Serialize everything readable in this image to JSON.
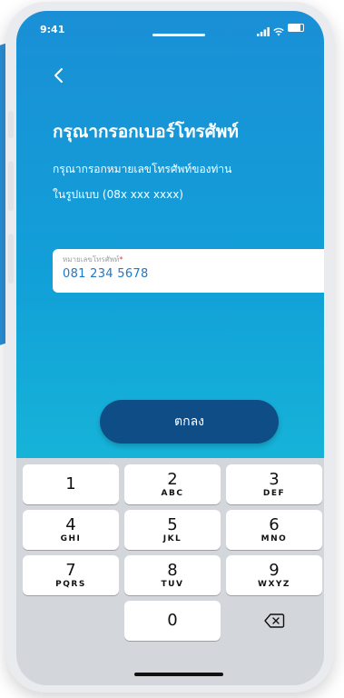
{
  "status": {
    "time": "9:41"
  },
  "header": {
    "title": "กรุณากรอกเบอร์โทรศัพท์",
    "subtitle_line1": "กรุณากรอกหมายเลขโทรศัพท์ของท่าน",
    "subtitle_line2": "ในรูปแบบ (08x xxx xxxx)"
  },
  "phone_field": {
    "label": "หมายเลขโทรศัพท์",
    "required_mark": "*",
    "value": "081 234 5678"
  },
  "ok_button": {
    "label": "ตกลง"
  },
  "keypad": {
    "keys": [
      {
        "digit": "1",
        "letters": ""
      },
      {
        "digit": "2",
        "letters": "ABC"
      },
      {
        "digit": "3",
        "letters": "DEF"
      },
      {
        "digit": "4",
        "letters": "GHI"
      },
      {
        "digit": "5",
        "letters": "JKL"
      },
      {
        "digit": "6",
        "letters": "MNO"
      },
      {
        "digit": "7",
        "letters": "PQRS"
      },
      {
        "digit": "8",
        "letters": "TUV"
      },
      {
        "digit": "9",
        "letters": "WXYZ"
      },
      {
        "digit": "0",
        "letters": ""
      }
    ],
    "delete_icon": "backspace-icon"
  },
  "colors": {
    "gradient_top": "#1a8fd6",
    "gradient_bottom": "#16b3d8",
    "button": "#0f4d87",
    "field_value": "#1e78c8"
  }
}
